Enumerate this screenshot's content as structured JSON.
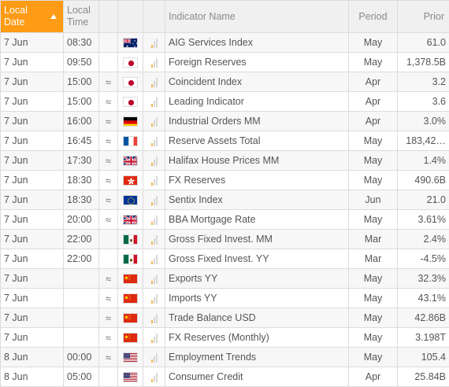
{
  "headers": {
    "local_date": "Local Date",
    "local_time": "Local Time",
    "indicator_name": "Indicator Name",
    "period": "Period",
    "prior": "Prior"
  },
  "rows": [
    {
      "date": "7 Jun",
      "time": "08:30",
      "approx": "",
      "flag": "australia-flag",
      "importance": 1,
      "indicator": "AIG Services Index",
      "period": "May",
      "prior": "61.0"
    },
    {
      "date": "7 Jun",
      "time": "09:50",
      "approx": "",
      "flag": "japan-flag",
      "importance": 1,
      "indicator": "Foreign Reserves",
      "period": "May",
      "prior": "1,378.5B"
    },
    {
      "date": "7 Jun",
      "time": "15:00",
      "approx": "≈",
      "flag": "japan-flag",
      "importance": 1,
      "indicator": "Coincident Index",
      "period": "Apr",
      "prior": "3.2"
    },
    {
      "date": "7 Jun",
      "time": "15:00",
      "approx": "≈",
      "flag": "japan-flag",
      "importance": 1,
      "indicator": "Leading Indicator",
      "period": "Apr",
      "prior": "3.6"
    },
    {
      "date": "7 Jun",
      "time": "16:00",
      "approx": "≈",
      "flag": "germany-flag",
      "importance": 1,
      "indicator": "Industrial Orders MM",
      "period": "Apr",
      "prior": "3.0%"
    },
    {
      "date": "7 Jun",
      "time": "16:45",
      "approx": "≈",
      "flag": "france-flag",
      "importance": 1,
      "indicator": "Reserve Assets Total",
      "period": "May",
      "prior": "183,42…"
    },
    {
      "date": "7 Jun",
      "time": "17:30",
      "approx": "≈",
      "flag": "uk-flag",
      "importance": 1,
      "indicator": "Halifax House Prices MM",
      "period": "May",
      "prior": "1.4%"
    },
    {
      "date": "7 Jun",
      "time": "18:30",
      "approx": "≈",
      "flag": "hongkong-flag",
      "importance": 1,
      "indicator": "FX Reserves",
      "period": "May",
      "prior": "490.6B"
    },
    {
      "date": "7 Jun",
      "time": "18:30",
      "approx": "≈",
      "flag": "eu-flag",
      "importance": 1,
      "indicator": "Sentix Index",
      "period": "Jun",
      "prior": "21.0"
    },
    {
      "date": "7 Jun",
      "time": "20:00",
      "approx": "≈",
      "flag": "uk-flag",
      "importance": 1,
      "indicator": "BBA Mortgage Rate",
      "period": "May",
      "prior": "3.61%"
    },
    {
      "date": "7 Jun",
      "time": "22:00",
      "approx": "",
      "flag": "mexico-flag",
      "importance": 1,
      "indicator": "Gross Fixed Invest. MM",
      "period": "Mar",
      "prior": "2.4%"
    },
    {
      "date": "7 Jun",
      "time": "22:00",
      "approx": "",
      "flag": "mexico-flag",
      "importance": 1,
      "indicator": "Gross Fixed Invest. YY",
      "period": "Mar",
      "prior": "-4.5%"
    },
    {
      "date": "7 Jun",
      "time": "",
      "approx": "≈",
      "flag": "china-flag",
      "importance": 1,
      "indicator": "Exports YY",
      "period": "May",
      "prior": "32.3%"
    },
    {
      "date": "7 Jun",
      "time": "",
      "approx": "≈",
      "flag": "china-flag",
      "importance": 1,
      "indicator": "Imports YY",
      "period": "May",
      "prior": "43.1%"
    },
    {
      "date": "7 Jun",
      "time": "",
      "approx": "≈",
      "flag": "china-flag",
      "importance": 1,
      "indicator": "Trade Balance USD",
      "period": "May",
      "prior": "42.86B"
    },
    {
      "date": "7 Jun",
      "time": "",
      "approx": "≈",
      "flag": "china-flag",
      "importance": 1,
      "indicator": "FX Reserves (Monthly)",
      "period": "May",
      "prior": "3.198T"
    },
    {
      "date": "8 Jun",
      "time": "00:00",
      "approx": "≈",
      "flag": "usa-flag",
      "importance": 1,
      "indicator": "Employment Trends",
      "period": "May",
      "prior": "105.4"
    },
    {
      "date": "8 Jun",
      "time": "05:00",
      "approx": "",
      "flag": "usa-flag",
      "importance": 1,
      "indicator": "Consumer Credit",
      "period": "Apr",
      "prior": "25.84B"
    }
  ],
  "colors": {
    "sorted_header": "#ff9b14",
    "importance_on": "#f2b84b",
    "importance_off": "#d8d8d8"
  }
}
